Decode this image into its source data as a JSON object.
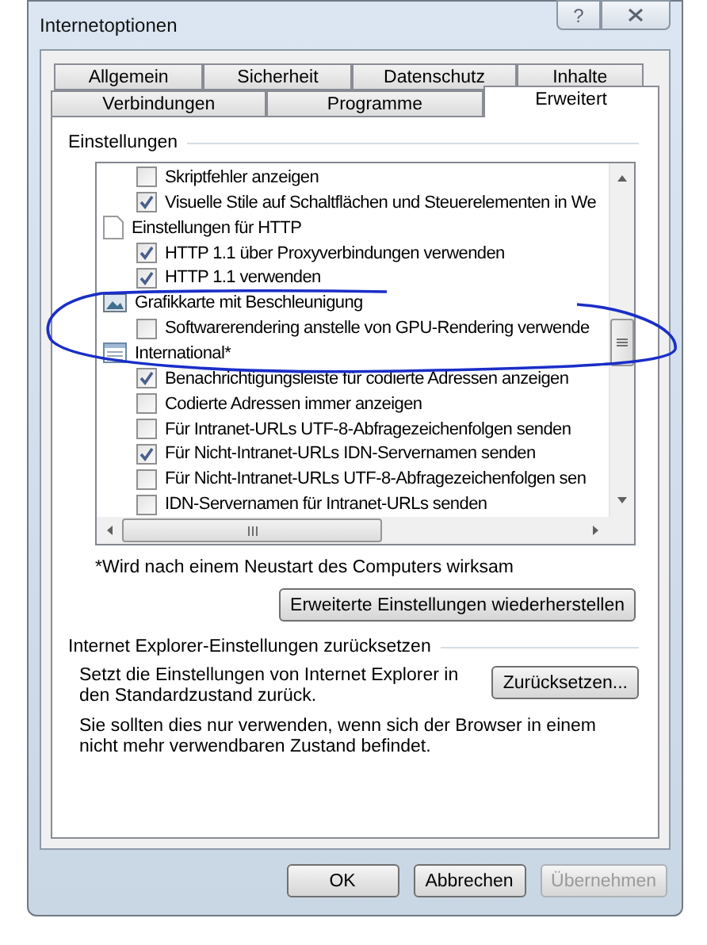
{
  "window": {
    "title": "Internetoptionen",
    "help": "?"
  },
  "tabs": [
    [
      {
        "label": "Allgemein",
        "selected": false
      },
      {
        "label": "Sicherheit",
        "selected": false
      },
      {
        "label": "Datenschutz",
        "selected": false
      },
      {
        "label": "Inhalte",
        "selected": false
      }
    ],
    [
      {
        "label": "Verbindungen",
        "selected": false
      },
      {
        "label": "Programme",
        "selected": false
      },
      {
        "label": "Erweitert",
        "selected": true
      }
    ]
  ],
  "settings": {
    "title": "Einstellungen",
    "items": [
      {
        "kind": "checkbox",
        "label": "Skriptfehler anzeigen",
        "checked": false
      },
      {
        "kind": "checkbox",
        "label": "Visuelle Stile auf Schaltflächen und Steuerelementen in We",
        "checked": true
      },
      {
        "kind": "heading",
        "label": "Einstellungen für HTTP"
      },
      {
        "kind": "checkbox",
        "label": "HTTP 1.1 über Proxyverbindungen verwenden",
        "checked": true
      },
      {
        "kind": "checkbox",
        "label": "HTTP 1.1 verwenden",
        "checked": true
      },
      {
        "kind": "heading",
        "label": "Grafikkarte mit Beschleunigung"
      },
      {
        "kind": "checkbox",
        "label": "Softwarerendering anstelle von GPU-Rendering verwende",
        "checked": false
      },
      {
        "kind": "heading",
        "label": "International*"
      },
      {
        "kind": "checkbox",
        "label": "Benachrichtigungsleiste für codierte Adressen anzeigen",
        "checked": true
      },
      {
        "kind": "checkbox",
        "label": "Codierte Adressen immer anzeigen",
        "checked": false
      },
      {
        "kind": "checkbox",
        "label": "Für Intranet-URLs UTF-8-Abfragezeichenfolgen senden",
        "checked": false
      },
      {
        "kind": "checkbox",
        "label": "Für Nicht-Intranet-URLs IDN-Servernamen senden",
        "checked": true
      },
      {
        "kind": "checkbox",
        "label": "Für Nicht-Intranet-URLs UTF-8-Abfragezeichenfolgen sen",
        "checked": false
      },
      {
        "kind": "checkbox",
        "label": "IDN-Servernamen für Intranet-URLs senden",
        "checked": false
      }
    ],
    "note": "*Wird nach einem Neustart des Computers wirksam",
    "restore_button": "Erweiterte Einstellungen wiederherstellen"
  },
  "reset": {
    "title": "Internet Explorer-Einstellungen zurücksetzen",
    "description": "Setzt die Einstellungen von Internet Explorer in den Standardzustand zurück.",
    "button": "Zurücksetzen...",
    "warning": "Sie sollten dies nur verwenden, wenn sich der Browser in einem nicht mehr verwendbaren Zustand befindet."
  },
  "buttons": [
    {
      "label": "OK",
      "disabled": false
    },
    {
      "label": "Abbrechen",
      "disabled": false
    },
    {
      "label": "Übernehmen",
      "disabled": true
    }
  ]
}
